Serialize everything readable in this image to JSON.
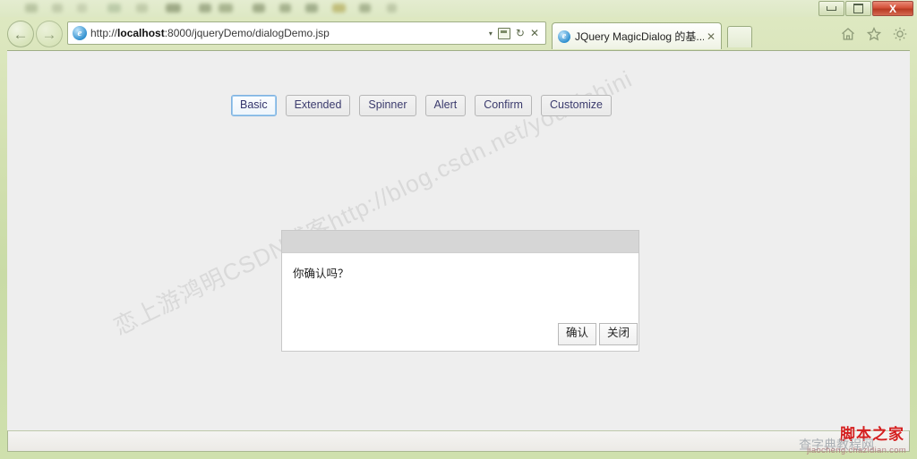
{
  "window": {
    "controls": {
      "minimize_label": "Minimize",
      "maximize_label": "Restore",
      "close_label": "X"
    }
  },
  "browser": {
    "back_label": "←",
    "forward_label": "→",
    "address": {
      "url_scheme": "http://",
      "url_host": "localhost",
      "url_rest": ":8000/jqueryDemo/dialogDemo.jsp",
      "full_url": "http://localhost:8000/jqueryDemo/dialogDemo.jsp",
      "placeholder": "",
      "dropdown_caret": "▾",
      "compat_icon": "compatibility-view-icon",
      "refresh_label": "↻",
      "stop_label": "✕"
    },
    "tabs": [
      {
        "title": "JQuery MagicDialog 的基...",
        "close_label": "✕",
        "favicon": "ie-favicon",
        "active": true
      }
    ],
    "new_tab_label": "",
    "toolbar_icons": [
      {
        "name": "home-icon"
      },
      {
        "name": "favorites-star-icon"
      },
      {
        "name": "settings-gear-icon"
      }
    ]
  },
  "page": {
    "buttons": [
      {
        "label": "Basic",
        "focused": true
      },
      {
        "label": "Extended",
        "focused": false
      },
      {
        "label": "Spinner",
        "focused": false
      },
      {
        "label": "Alert",
        "focused": false
      },
      {
        "label": "Confirm",
        "focused": false
      },
      {
        "label": "Customize",
        "focused": false
      }
    ],
    "dialog": {
      "title": "",
      "message": "你确认吗？",
      "buttons": [
        {
          "label": "确认"
        },
        {
          "label": "关闭"
        }
      ]
    },
    "watermark_diagonal": "恋上游鸿明CSDN博客http://blog.csdn.net/youqishini"
  },
  "statusbar": {
    "text": ""
  },
  "overlay_watermark": {
    "red_text": "脚本之家",
    "gray_text": "查字典教程网",
    "url_text": "jiaocheng.chazidian.com"
  },
  "colors": {
    "chrome_green": "#cfe0ad",
    "page_bg": "#eeeeee",
    "dialog_header": "#d6d6d6",
    "focus_blue": "#7fb2e0",
    "watermark_red": "#d41f1f"
  }
}
